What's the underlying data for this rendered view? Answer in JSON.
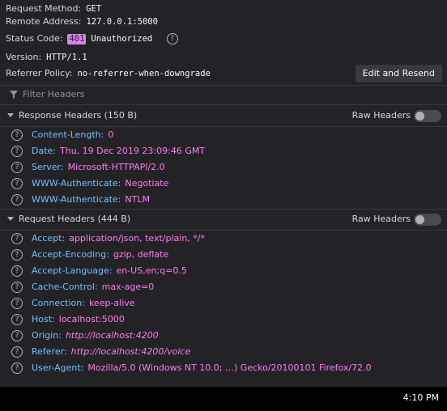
{
  "summary": {
    "request_method_label": "Request Method:",
    "request_method_value": "GET",
    "remote_address_label": "Remote Address:",
    "remote_address_value": "127.0.0.1:5000",
    "status_code_label": "Status Code:",
    "status_code_value": "401",
    "status_text": "Unauthorized",
    "version_label": "Version:",
    "version_value": "HTTP/1.1",
    "referrer_policy_label": "Referrer Policy:",
    "referrer_policy_value": "no-referrer-when-downgrade",
    "edit_resend_label": "Edit and Resend"
  },
  "filter": {
    "placeholder": "Filter Headers"
  },
  "response_headers": {
    "title": "Response Headers (150 B)",
    "raw_label": "Raw Headers",
    "raw_enabled": false,
    "items": [
      {
        "name": "Content-Length:",
        "value": "0",
        "italic": false
      },
      {
        "name": "Date:",
        "value": "Thu, 19 Dec 2019 23:09:46 GMT",
        "italic": false
      },
      {
        "name": "Server:",
        "value": "Microsoft-HTTPAPI/2.0",
        "italic": false
      },
      {
        "name": "WWW-Authenticate:",
        "value": "Negotiate",
        "italic": false
      },
      {
        "name": "WWW-Authenticate:",
        "value": "NTLM",
        "italic": false
      }
    ]
  },
  "request_headers": {
    "title": "Request Headers (444 B)",
    "raw_label": "Raw Headers",
    "raw_enabled": false,
    "items": [
      {
        "name": "Accept:",
        "value": "application/json, text/plain, */*",
        "italic": false
      },
      {
        "name": "Accept-Encoding:",
        "value": "gzip, deflate",
        "italic": false
      },
      {
        "name": "Accept-Language:",
        "value": "en-US,en;q=0.5",
        "italic": false
      },
      {
        "name": "Cache-Control:",
        "value": "max-age=0",
        "italic": false
      },
      {
        "name": "Connection:",
        "value": "keep-alive",
        "italic": false
      },
      {
        "name": "Host:",
        "value": "localhost:5000",
        "italic": false
      },
      {
        "name": "Origin:",
        "value": "http://localhost:4200",
        "italic": true
      },
      {
        "name": "Referer:",
        "value": "http://localhost:4200/voice",
        "italic": true
      },
      {
        "name": "User-Agent:",
        "value": "Mozilla/5.0 (Windows NT 10.0; …) Gecko/20100101 Firefox/72.0",
        "italic": false
      }
    ]
  },
  "taskbar": {
    "clock": "4:10 PM"
  },
  "colors": {
    "background": "#232327",
    "header_name": "#75bfff",
    "header_value": "#ff7de9",
    "status_badge": "#d785e6"
  }
}
